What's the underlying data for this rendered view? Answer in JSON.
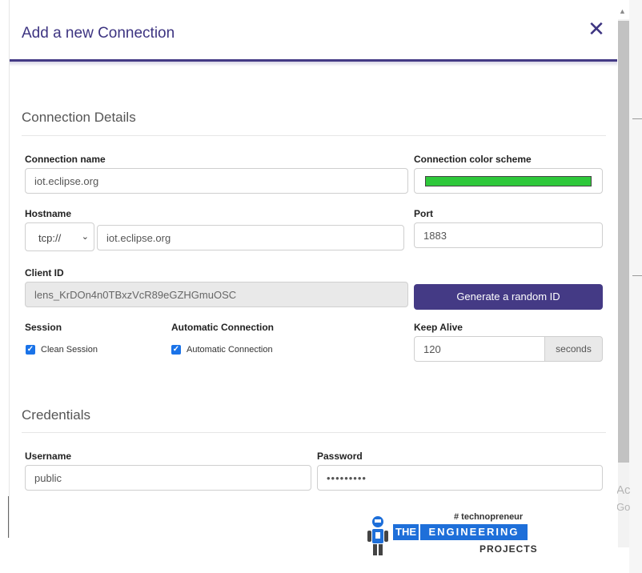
{
  "dialog": {
    "title": "Add a new Connection",
    "close_icon": "close-icon",
    "accent_color": "#443a85"
  },
  "connection_details": {
    "section_title": "Connection Details",
    "connection_name": {
      "label": "Connection name",
      "value": "iot.eclipse.org"
    },
    "color_scheme": {
      "label": "Connection color scheme",
      "color": "#2ec83a"
    },
    "hostname": {
      "label": "Hostname",
      "protocol": "tcp://",
      "value": "iot.eclipse.org"
    },
    "port": {
      "label": "Port",
      "value": "1883"
    },
    "client_id": {
      "label": "Client ID",
      "value": "lens_KrDOn4n0TBxzVcR89eGZHGmuOSC",
      "generate_label": "Generate a random ID"
    },
    "session": {
      "label": "Session",
      "checkbox_label": "Clean Session",
      "checked": true
    },
    "automatic_connection": {
      "label": "Automatic Connection",
      "checkbox_label": "Automatic Connection",
      "checked": true
    },
    "keep_alive": {
      "label": "Keep Alive",
      "value": "120",
      "unit": "seconds"
    }
  },
  "credentials": {
    "section_title": "Credentials",
    "username": {
      "label": "Username",
      "value": "public"
    },
    "password": {
      "label": "Password",
      "value": "•••••••••"
    }
  },
  "background": {
    "ghost_text_1": "Ac",
    "ghost_text_2": "Go"
  },
  "watermark": {
    "hashtag": "# technopreneur",
    "the": "THE",
    "engineering": "ENGINEERING",
    "projects": "PROJECTS"
  }
}
